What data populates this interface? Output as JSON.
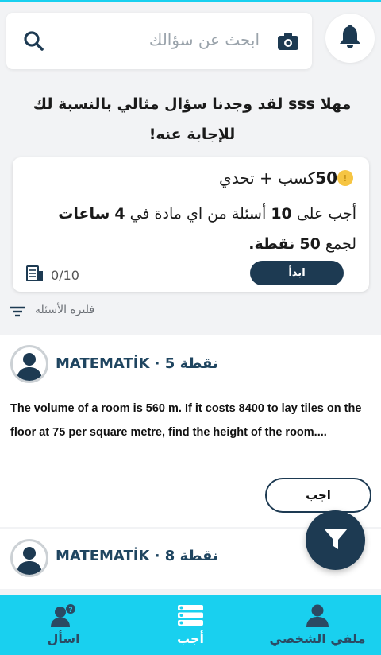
{
  "search": {
    "placeholder": "ابحث عن سؤالك"
  },
  "greeting": "مهلا sss لقد وجدنا سؤال مثالي بالنسبة لك للإجابة عنه!",
  "challenge": {
    "points": "50",
    "title_suffix": "كسب + تحدي",
    "desc_1": "أجب على",
    "count": "10",
    "desc_2": "أسئلة من اي مادة في",
    "hours": "4",
    "desc_3": "ساعات",
    "desc_4": "لجمع",
    "reward": "50",
    "desc_5": "نقطة.",
    "start_label": "ابدأ",
    "progress": "0/10"
  },
  "filter": {
    "label": "فلترة الأسئلة"
  },
  "questions": [
    {
      "subject": "MATEMATİK",
      "sep": " · ",
      "points": "5",
      "points_unit": "نقطة",
      "text": "The volume of a room is 560 m. If it costs 8400 to lay tiles on the floor at 75 per square metre, find the height of the room....",
      "answer_label": "اجب"
    },
    {
      "subject": "MATEMATİK",
      "sep": " · ",
      "points": "8",
      "points_unit": "نقطة"
    }
  ],
  "nav": {
    "ask": "اسأل",
    "answer": "أجب",
    "profile": "ملفي الشخصي"
  },
  "colors": {
    "accent": "#19d0ef",
    "primary": "#1d3a52"
  },
  "icons": [
    "search-icon",
    "camera-icon",
    "bell-icon",
    "coin-icon",
    "tasks-icon",
    "filter-icon",
    "avatar-icon",
    "funnel-icon",
    "ask-icon",
    "list-icon",
    "profile-icon"
  ]
}
